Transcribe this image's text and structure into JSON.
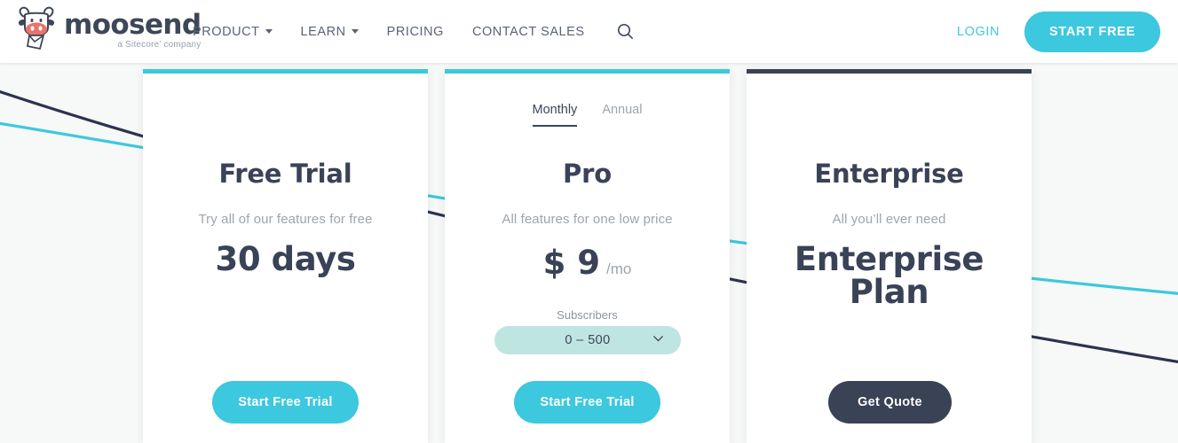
{
  "header": {
    "logo": {
      "icon": "cow-head-icon",
      "wordmark": "moosend",
      "tagline": "a Sitecore’ company"
    },
    "nav": [
      {
        "label": "PRODUCT",
        "has_caret": true
      },
      {
        "label": "LEARN",
        "has_caret": true
      },
      {
        "label": "PRICING",
        "has_caret": false
      },
      {
        "label": "CONTACT SALES",
        "has_caret": false
      }
    ],
    "search_icon": "search-icon",
    "login_label": "LOGIN",
    "cta_label": "START FREE",
    "accent_color": "#3cc8de",
    "nav_text_color": "#5a6374"
  },
  "pricing": {
    "cards": [
      {
        "id": "free-trial",
        "top_border_color": "#3cc8de",
        "title": "Free Trial",
        "subtitle": "Try all of our features for free",
        "headline": "30 days",
        "cta_label": "Start Free Trial",
        "cta_color": "#3cc8de"
      },
      {
        "id": "pro",
        "top_border_color": "#3cc8de",
        "billing_toggle": {
          "options": [
            "Monthly",
            "Annual"
          ],
          "selected": "Monthly"
        },
        "title": "Pro",
        "subtitle": "All features for one low price",
        "price_amount": "$ 9",
        "price_period": "/mo",
        "subscribers_label": "Subscribers",
        "subscribers_value": "0 – 500",
        "subscribers_pill_color": "#bfe5e2",
        "dropdown_icon": "chevron-down-icon",
        "cta_label": "Start Free Trial",
        "cta_color": "#3cc8de"
      },
      {
        "id": "enterprise",
        "top_border_color": "#3a4256",
        "title": "Enterprise",
        "subtitle": "All you’ll ever need",
        "headline_line1": "Enterprise",
        "headline_line2": "Plan",
        "cta_label": "Get Quote",
        "cta_color": "#3a4256"
      }
    ]
  },
  "background": {
    "curve_dark_color": "#2c3350",
    "curve_teal_color": "#3cc8de",
    "page_color": "#f7f8f8"
  }
}
